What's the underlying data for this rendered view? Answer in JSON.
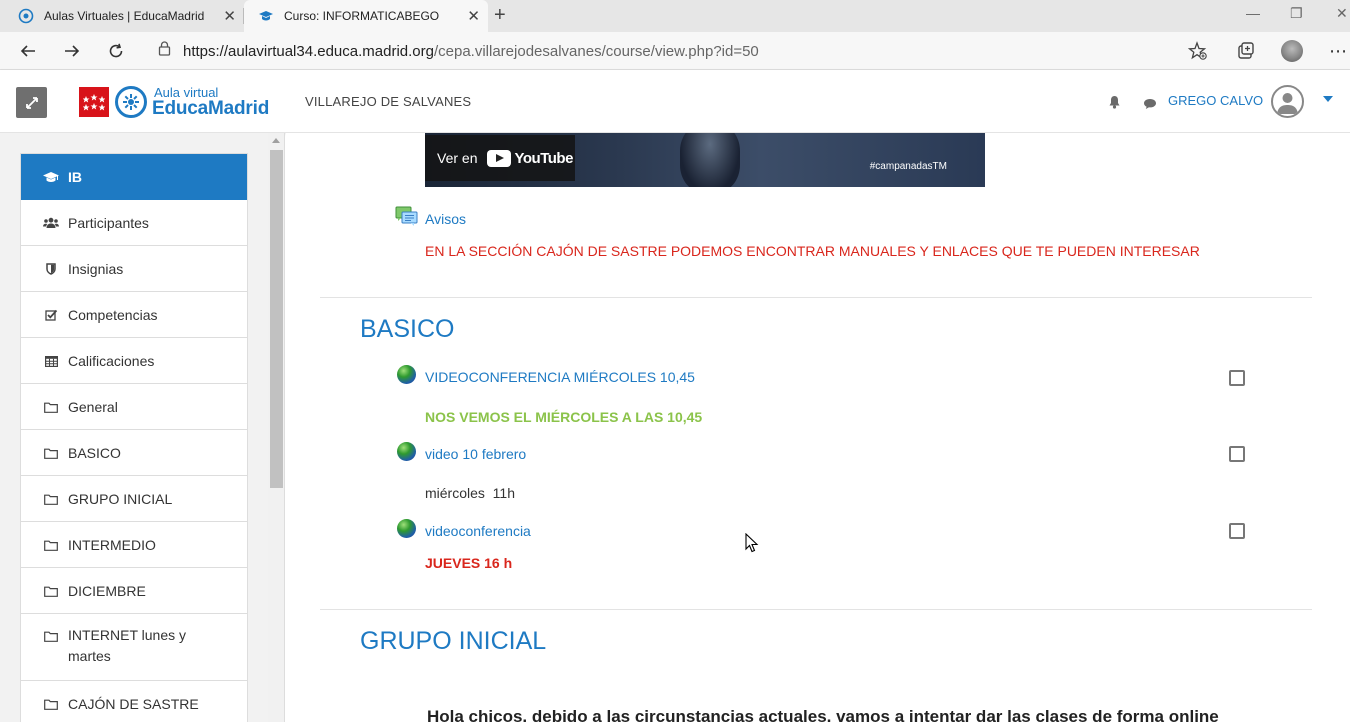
{
  "browser": {
    "tabs": [
      {
        "title": "Aulas Virtuales | EducaMadrid",
        "active": false
      },
      {
        "title": "Curso: INFORMATICABEGO",
        "active": true
      }
    ],
    "url_host": "https://aulavirtual34.educa.madrid.org",
    "url_path": "/cepa.villarejodesalvanes/course/view.php?id=50"
  },
  "navbar": {
    "logo_small": "Aula virtual",
    "logo_big": "EducaMadrid",
    "site_name": "VILLAREJO DE SALVANES",
    "user_name": "GREGO CALVO"
  },
  "sidebar": {
    "items": [
      {
        "label": "IB",
        "icon": "graduation-cap-icon",
        "active": true
      },
      {
        "label": "Participantes",
        "icon": "users-icon"
      },
      {
        "label": "Insignias",
        "icon": "shield-icon"
      },
      {
        "label": "Competencias",
        "icon": "check-square-icon"
      },
      {
        "label": "Calificaciones",
        "icon": "table-icon"
      },
      {
        "label": "General",
        "icon": "folder-icon"
      },
      {
        "label": "BASICO",
        "icon": "folder-icon"
      },
      {
        "label": "GRUPO INICIAL",
        "icon": "folder-icon"
      },
      {
        "label": "INTERMEDIO",
        "icon": "folder-icon"
      },
      {
        "label": "DICIEMBRE",
        "icon": "folder-icon"
      },
      {
        "label": "INTERNET lunes y martes",
        "icon": "folder-icon"
      },
      {
        "label": "CAJÓN DE SASTRE",
        "icon": "folder-icon"
      }
    ]
  },
  "main": {
    "video": {
      "watch_on": "Ver en",
      "youtube": "YouTube",
      "hashtag": "#campanadasTM"
    },
    "general": {
      "forum_label": "Avisos",
      "notice": "EN LA SECCIÓN CAJÓN DE SASTRE PODEMOS ENCONTRAR MANUALES Y ENLACES QUE TE PUEDEN INTERESAR"
    },
    "basico": {
      "title": "BASICO",
      "activities": [
        {
          "label": "VIDEOCONFERENCIA MIÉRCOLES 10,45",
          "note": "NOS VEMOS EL MIÉRCOLES A LAS 10,45"
        },
        {
          "label": "video 10 febrero",
          "note": "miércoles  11h"
        },
        {
          "label": "videoconferencia",
          "note": "JUEVES 16 h"
        }
      ]
    },
    "grupo_inicial": {
      "title": "GRUPO INICIAL",
      "intro": "Hola chicos, debido a las circunstancias actuales, vamos a intentar dar las clases de forma online"
    }
  },
  "colors": {
    "accent": "#1e7ac3",
    "notice_red": "#d9261c",
    "note_green": "#8bc34a"
  }
}
